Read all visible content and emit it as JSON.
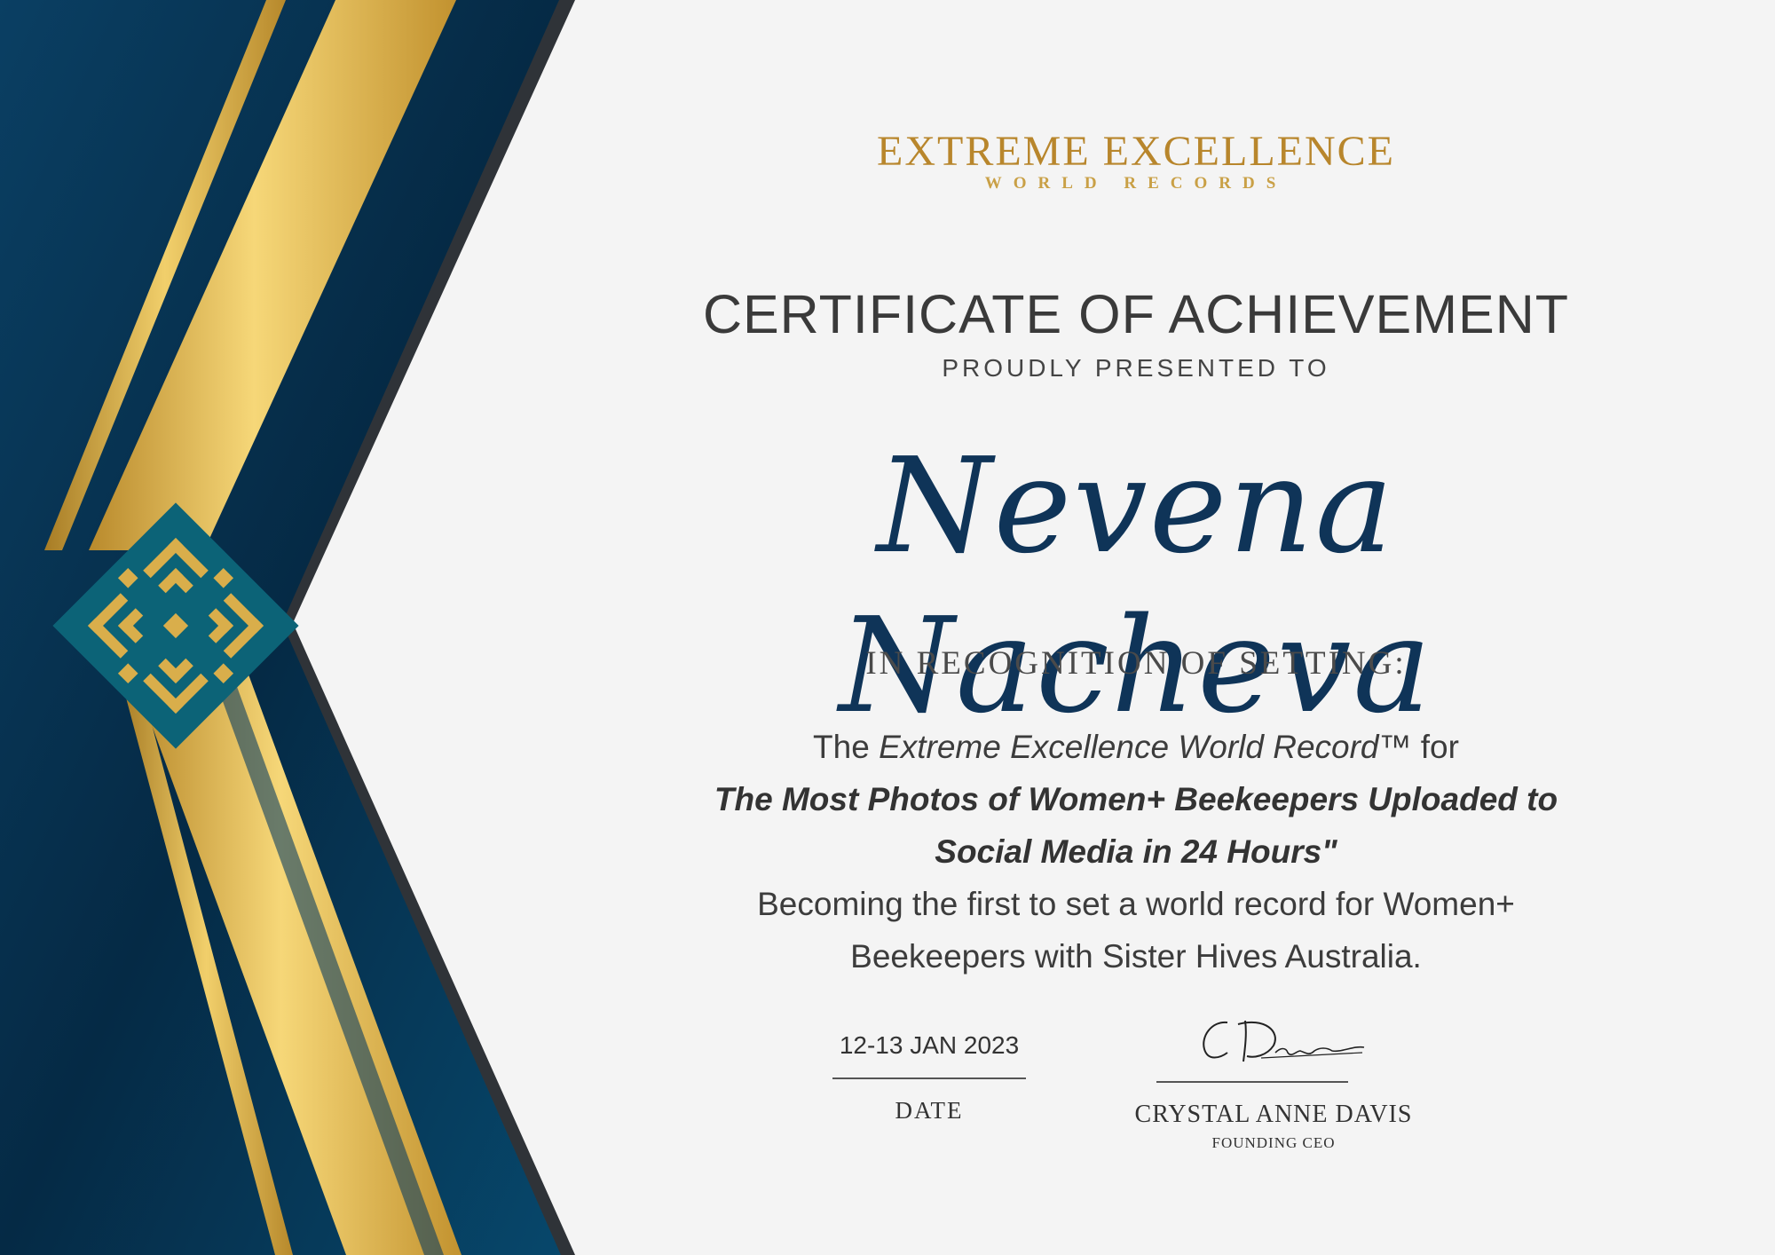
{
  "org": {
    "name": "EXTREME EXCELLENCE",
    "subtitle": "WORLD RECORDS"
  },
  "certificate": {
    "title": "CERTIFICATE OF ACHIEVEMENT",
    "presented_to": "PROUDLY PRESENTED TO",
    "recipient": "Nevena Nacheva",
    "recognition_heading": "IN RECOGNITION OF SETTING:"
  },
  "description": {
    "line1_prefix": "The",
    "line1_record": "Extreme Excellence World Record™",
    "line1_suffix": "for",
    "line2": "The Most Photos of Women+ Beekeepers Uploaded to",
    "line3": "Social Media in 24 Hours\"",
    "line4": "Becoming the first to set a world record for Women+",
    "line5": "Beekeepers with Sister Hives Australia."
  },
  "date": {
    "value": "12-13 JAN 2023",
    "label": "DATE"
  },
  "signatory": {
    "name": "CRYSTAL ANNE DAVIS",
    "role": "FOUNDING CEO"
  },
  "colors": {
    "navy": "#0f3458",
    "teal_dark": "#073c5e",
    "gold": "#d8b04a",
    "gold_text": "#b8862c",
    "text_dark": "#3a3a3a",
    "background": "#f4f4f4"
  }
}
